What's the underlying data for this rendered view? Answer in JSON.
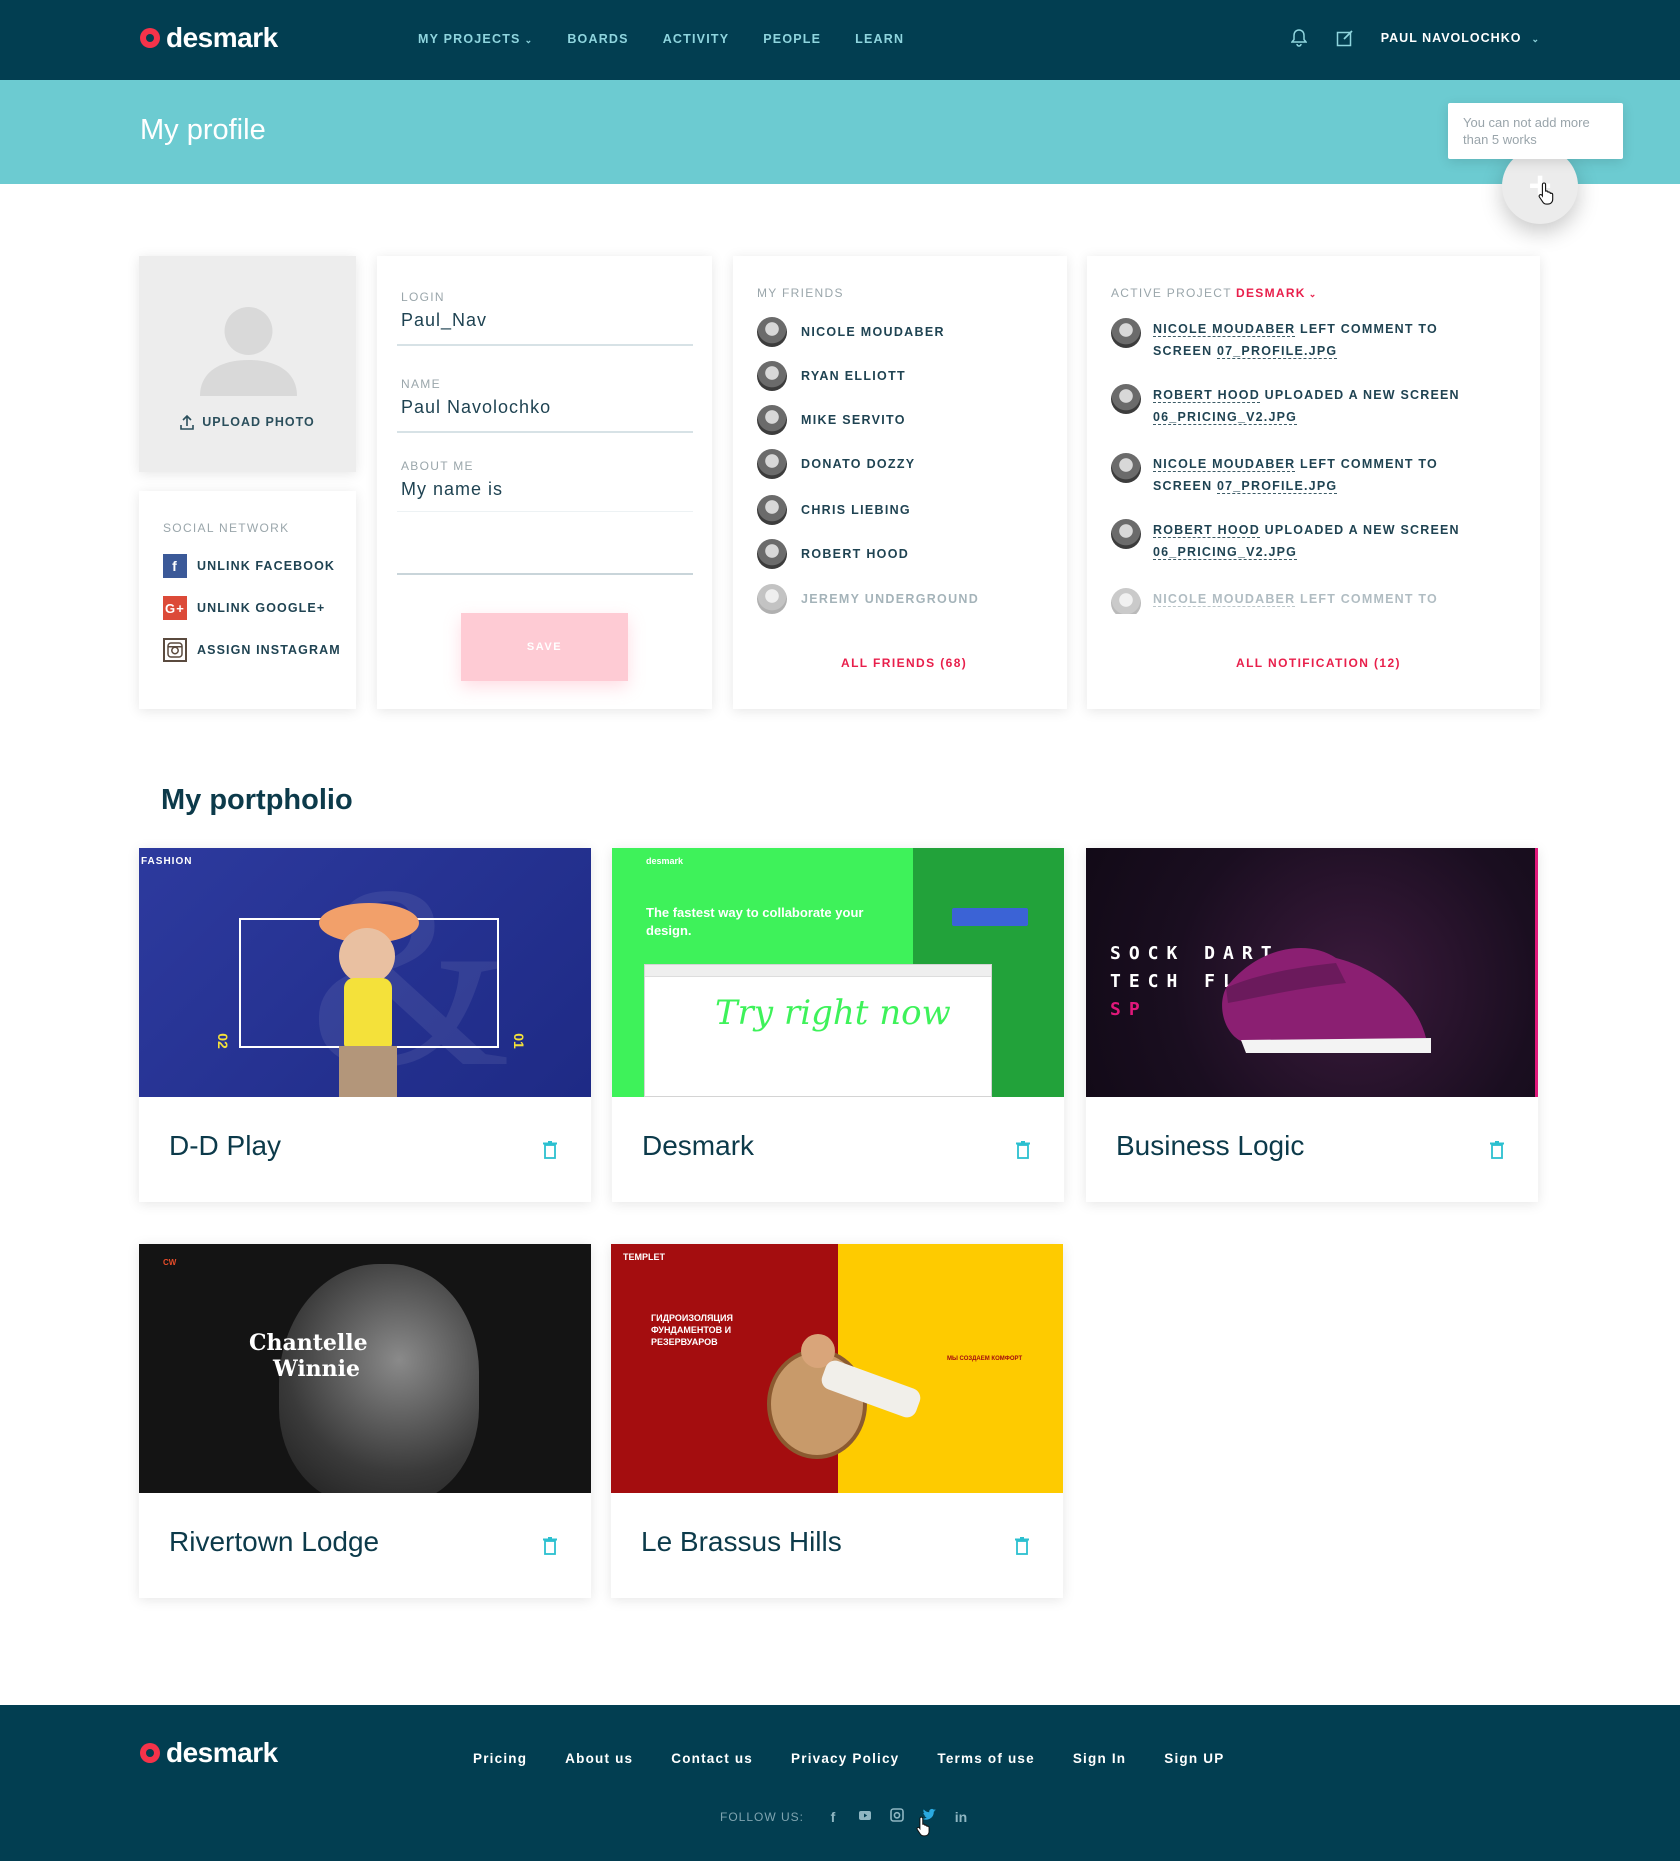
{
  "nav": {
    "brand": "desmark",
    "links": [
      "MY PROJECTS",
      "BOARDS",
      "ACTIVITY",
      "PEOPLE",
      "LEARN"
    ],
    "user": "PAUL NAVOLOCHKO",
    "icons": [
      "bell-icon",
      "edit-icon"
    ]
  },
  "header": {
    "title": "My profile",
    "tooltip": "You can not add more than 5 works",
    "fab_icon": "plus-icon"
  },
  "photo": {
    "upload_label": "UPLOAD PHOTO"
  },
  "social": {
    "label": "SOCIAL NETWORK",
    "items": [
      {
        "icon": "f",
        "label": "UNLINK FACEBOOK"
      },
      {
        "icon": "G+",
        "label": "UNLINK GOOGLE+"
      },
      {
        "icon": "instagram",
        "label": "ASSIGN INSTAGRAM"
      }
    ]
  },
  "form": {
    "login_label": "LOGIN",
    "login_value": "Paul_Nav",
    "name_label": "NAME",
    "name_value": "Paul Navolochko",
    "about_label": "ABOUT ME",
    "about_value": "My name is",
    "save_label": "SAVE"
  },
  "friends": {
    "label": "MY FRIENDS",
    "items": [
      "NICOLE MOUDABER",
      "RYAN ELLIOTT",
      "MIKE SERVITO",
      "DONATO DOZZY",
      "CHRIS LIEBING",
      "ROBERT HOOD",
      "JEREMY UNDERGROUND"
    ],
    "all_link": "ALL FRIENDS (68)"
  },
  "activity": {
    "label": "ACTIVE PROJECT",
    "project": "DESMARK",
    "items": [
      {
        "user": "NICOLE MOUDABER",
        "action": " LEFT COMMENT TO SCREEN ",
        "file": "07_PROFILE.JPG"
      },
      {
        "user": "ROBERT HOOD",
        "action": " UPLOADED A NEW SCREEN ",
        "file": "06_PRICING_V2.JPG"
      },
      {
        "user": "NICOLE MOUDABER",
        "action": " LEFT COMMENT TO SCREEN ",
        "file": "07_PROFILE.JPG"
      },
      {
        "user": "ROBERT HOOD",
        "action": " UPLOADED A NEW SCREEN ",
        "file": "06_PRICING_V2.JPG"
      },
      {
        "user": "NICOLE MOUDABER",
        "action": " LEFT COMMENT TO SCREEN ",
        "file": ""
      }
    ],
    "all_link": "ALL NOTIFICATION (12)"
  },
  "portfolio": {
    "title": "My portpholio",
    "items": [
      {
        "title": "D-D Play",
        "thumb": {
          "brand": "FASHION",
          "num_left": "02",
          "num_right": "01"
        }
      },
      {
        "title": "Desmark",
        "thumb": {
          "brand": "desmark",
          "headline": "The fastest way to collaborate your design.",
          "script": "Try right now"
        }
      },
      {
        "title": "Business Logic",
        "thumb": {
          "line1": "SOCK DART",
          "line2": "TECH FLEECE",
          "line3": "SP"
        }
      },
      {
        "title": "Rivertown Lodge",
        "thumb": {
          "brand": "CW",
          "name1": "Chantelle",
          "name2": "Winnie"
        }
      },
      {
        "title": "Le Brassus Hills",
        "thumb": {
          "brand": "TEMPLET",
          "headline": "ГИДРОИЗОЛЯЦИЯ ФУНДАМЕНТОВ И РЕЗЕРВУАРОВ",
          "sub": "МЫ СОЗДАЕМ КОМФОРТ"
        }
      }
    ]
  },
  "footer": {
    "brand": "desmark",
    "links": [
      "Pricing",
      "About us",
      "Contact us",
      "Privacy Policy",
      "Terms of use",
      "Sign In",
      "Sign UP"
    ],
    "follow_label": "FOLLOW US:",
    "social": [
      "f",
      "yt",
      "ig",
      "tw",
      "in"
    ]
  },
  "colors": {
    "navy": "#023e51",
    "teal": "#6ccbd1",
    "accent": "#e81f4b",
    "save_disabled": "#fecbd4"
  }
}
